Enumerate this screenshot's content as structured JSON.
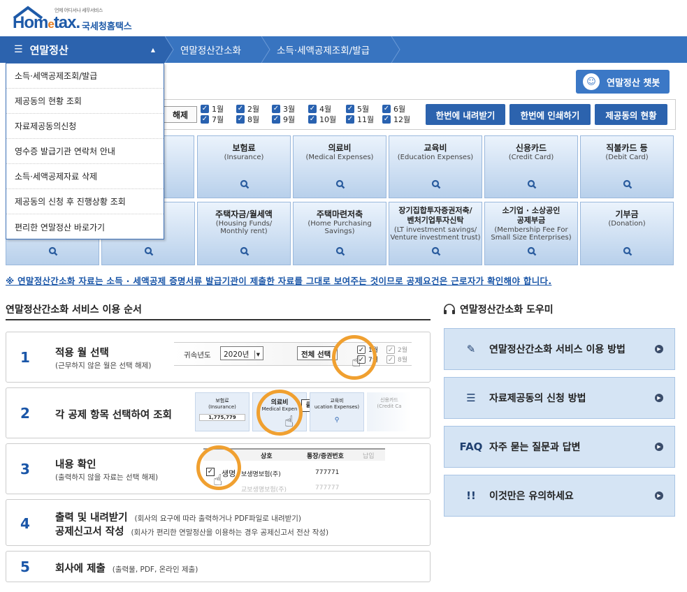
{
  "logo": {
    "small": "언제 어디서나 세무서비스",
    "brand_main": "Hom",
    "brand_e": "e",
    "brand_tail": "tax.",
    "brand_kr": "국세청홈택스"
  },
  "nav": {
    "menu_label": "연말정산",
    "crumbs": [
      "연말정산간소화",
      "소득·세액공제조회/발급"
    ]
  },
  "dropdown": {
    "items": [
      "소득·세액공제조회/발급",
      "제공동의 현황 조회",
      "자료제공동의신청",
      "영수증 발급기관 연락처 안내",
      "소득·세액공제자료 삭제",
      "제공동의 신청 후 진행상황 조회",
      "편리한 연말정산 바로가기"
    ]
  },
  "chatbot": {
    "label": "연말정산 챗봇"
  },
  "months": {
    "clear_label": "해제",
    "checkbox_mark": "✓",
    "list": [
      "1월",
      "2월",
      "3월",
      "4월",
      "5월",
      "6월",
      "7월",
      "8월",
      "9월",
      "10월",
      "11월",
      "12월"
    ],
    "buttons": [
      "한번에 내려받기",
      "한번에 인쇄하기",
      "제공동의 현황"
    ]
  },
  "deductions_row1": [
    {
      "title": "",
      "sub": "sion)"
    },
    {
      "title": "보험료",
      "sub": "(Insurance)"
    },
    {
      "title": "의료비",
      "sub": "(Medical Expenses)"
    },
    {
      "title": "교육비",
      "sub": "(Education Expenses)"
    },
    {
      "title": "신용카드",
      "sub": "(Credit Card)"
    },
    {
      "title": "직불카드 등",
      "sub": "(Debit Card)"
    }
  ],
  "deductions_row2": [
    {
      "title": "",
      "sub": ""
    },
    {
      "title": "축/",
      "sub": "ngs)"
    },
    {
      "title": "주택자금/월세액",
      "sub": "(Housing Funds/\nMonthly rent)"
    },
    {
      "title": "주택마련저축",
      "sub": "(Home Purchasing Savings)"
    },
    {
      "title": "장기집합투자증권저축/\n벤처기업투자신탁",
      "sub": "(LT investment savings/\nVenture investment trust)"
    },
    {
      "title": "소기업 · 소상공인\n공제부금",
      "sub": "(Membership Fee For\nSmall Size Enterprises)"
    },
    {
      "title": "기부금",
      "sub": "(Donation)"
    }
  ],
  "notice": "※ 연말정산간소화 자료는 소득 · 세액공제 증명서류 발급기관이 제출한 자료를 그대로 보여주는 것이므로 공제요건은 근로자가 확인해야 합니다.",
  "steps_title": "연말정산간소화 서비스 이용 순서",
  "steps": [
    {
      "num": "1",
      "title": "적용 월 선택",
      "sub": "(근무하지 않은 월은 선택 해제)"
    },
    {
      "num": "2",
      "title": "각 공제 항목 선택하여 조회",
      "sub": ""
    },
    {
      "num": "3",
      "title": "내용 확인",
      "sub": "(출력하지 않을 자료는 선택 해제)"
    },
    {
      "num": "4",
      "title": "출력 및 내려받기",
      "side": "(회사의 요구에 따라 출력하거나 PDF파일로 내려받기)",
      "title2": "공제신고서 작성",
      "side2": "(회사가 편리한 연말정산을 이용하는 경우 공제신고서 전산 작성)"
    },
    {
      "num": "5",
      "title": "회사에 제출",
      "side": "(출력물, PDF, 온라인 제출)"
    }
  ],
  "step_illus": {
    "s1": {
      "year_label": "귀속년도",
      "year_value": "2020년",
      "select_all": "전체 선택",
      "m1": "1월",
      "m7": "7월",
      "m2": "2월",
      "m8": "8월"
    },
    "s2": {
      "c1_title": "보험료",
      "c1_sub": "(Insurance)",
      "c1_value": "1,775,779",
      "c2_title": "의료비",
      "c2_sub": "Medical Expen",
      "click": "클릭!",
      "c3_title": "교육비",
      "c3_sub": "ucation Expenses)",
      "c4_title": "신용카드",
      "c4_sub": "(Credit Ca"
    },
    "s3": {
      "col1": "상호",
      "col2": "통장/증권번호",
      "col3": "납입",
      "row1_name": "생명",
      "row1_b": "보생명보험(주)",
      "row1_c": "777771",
      "row2_b": "교보생명보험(주)",
      "row2_c": "777777"
    }
  },
  "helper_title": "연말정산간소화 도우미",
  "helpers": [
    {
      "icon": "✎",
      "label": "연말정산간소화 서비스 이용 방법"
    },
    {
      "icon": "☰",
      "label": "자료제공동의 신청 방법"
    },
    {
      "icon": "FAQ",
      "label": "자주 묻는 질문과 답변"
    },
    {
      "icon": "!!",
      "label": "이것만은 유의하세요"
    }
  ]
}
